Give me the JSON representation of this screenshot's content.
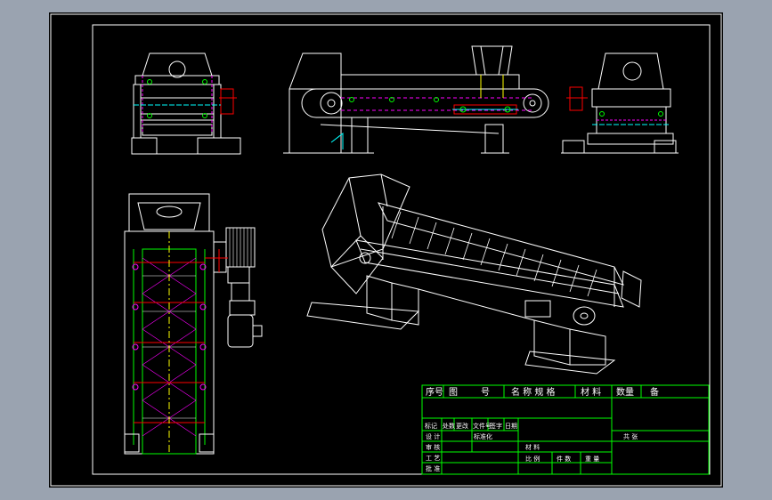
{
  "drawing": {
    "colors": {
      "background": "#9aa3b0",
      "canvas": "#000000",
      "line": "#ffffff",
      "frame_green": "#00ff00",
      "magenta": "#ff00ff",
      "red": "#ff0000",
      "cyan": "#00ffff",
      "yellow": "#ffff00"
    }
  },
  "title_block": {
    "header": {
      "seq": "序号",
      "drawing_no": "图",
      "drawing_no_2": "号",
      "name_spec": "名 称 规 格",
      "material": "材 料",
      "quantity": "数量",
      "remark": "备"
    },
    "rev_row": {
      "mark": "标记",
      "count": "处数",
      "zone": "更改",
      "doc_no": "文件号",
      "sign": "签字",
      "date": "日期"
    },
    "rows": {
      "design": "设 计",
      "check": "审 核",
      "approve": "批 准",
      "standard": "标准化",
      "process": "工 艺"
    },
    "material_label": "材 料",
    "scale_label": "比 例",
    "pieces_label": "件 数",
    "weight_label": "重 量",
    "sheets_label": "共   张"
  }
}
